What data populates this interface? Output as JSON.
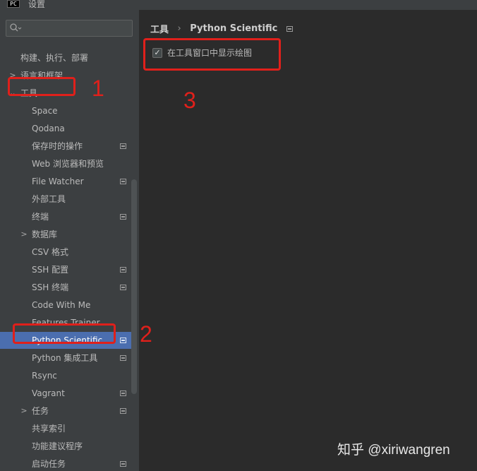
{
  "window": {
    "title": "设置",
    "icon_glyph": "PC"
  },
  "search": {
    "placeholder": "Q⌄"
  },
  "tree": {
    "items": [
      {
        "label": "构建、执行、部署",
        "level": 1,
        "chevron": "",
        "project": false
      },
      {
        "label": "语言和框架",
        "level": 1,
        "chevron": ">",
        "project": false
      },
      {
        "label": "工具",
        "level": 1,
        "chevron": "⌄",
        "project": false,
        "expanded": true
      },
      {
        "label": "Space",
        "level": 2,
        "chevron": "",
        "project": false
      },
      {
        "label": "Qodana",
        "level": 2,
        "chevron": "",
        "project": false
      },
      {
        "label": "保存时的操作",
        "level": 2,
        "chevron": "",
        "project": true
      },
      {
        "label": "Web 浏览器和预览",
        "level": 2,
        "chevron": "",
        "project": false
      },
      {
        "label": "File Watcher",
        "level": 2,
        "chevron": "",
        "project": true
      },
      {
        "label": "外部工具",
        "level": 2,
        "chevron": "",
        "project": false
      },
      {
        "label": "终端",
        "level": 2,
        "chevron": "",
        "project": true
      },
      {
        "label": "数据库",
        "level": 2,
        "chevron": ">",
        "project": false
      },
      {
        "label": "CSV 格式",
        "level": 2,
        "chevron": "",
        "project": false
      },
      {
        "label": "SSH 配置",
        "level": 2,
        "chevron": "",
        "project": true
      },
      {
        "label": "SSH 终端",
        "level": 2,
        "chevron": "",
        "project": true
      },
      {
        "label": "Code With Me",
        "level": 2,
        "chevron": "",
        "project": false
      },
      {
        "label": "Features Trainer",
        "level": 2,
        "chevron": "",
        "project": false
      },
      {
        "label": "Python Scientific",
        "level": 2,
        "chevron": "",
        "project": true,
        "selected": true
      },
      {
        "label": "Python 集成工具",
        "level": 2,
        "chevron": "",
        "project": true
      },
      {
        "label": "Rsync",
        "level": 2,
        "chevron": "",
        "project": false
      },
      {
        "label": "Vagrant",
        "level": 2,
        "chevron": "",
        "project": true
      },
      {
        "label": "任务",
        "level": 2,
        "chevron": ">",
        "project": true
      },
      {
        "label": "共享索引",
        "level": 2,
        "chevron": "",
        "project": false
      },
      {
        "label": "功能建议程序",
        "level": 2,
        "chevron": "",
        "project": false
      },
      {
        "label": "启动任务",
        "level": 2,
        "chevron": "",
        "project": true
      }
    ]
  },
  "breadcrumb": {
    "parent": "工具",
    "separator": "›",
    "current": "Python Scientific"
  },
  "settings": {
    "show_plots_checkbox": {
      "label": "在工具窗口中显示绘图",
      "checked": true,
      "mark": "✓"
    }
  },
  "annotations": {
    "one": "1",
    "two": "2",
    "three": "3"
  },
  "watermark": "知乎 @xiriwangren",
  "colors": {
    "annotation": "#e0201b",
    "selection": "#4b6eaf",
    "sidebar": "#3c3f41",
    "main": "#2b2b2b"
  }
}
